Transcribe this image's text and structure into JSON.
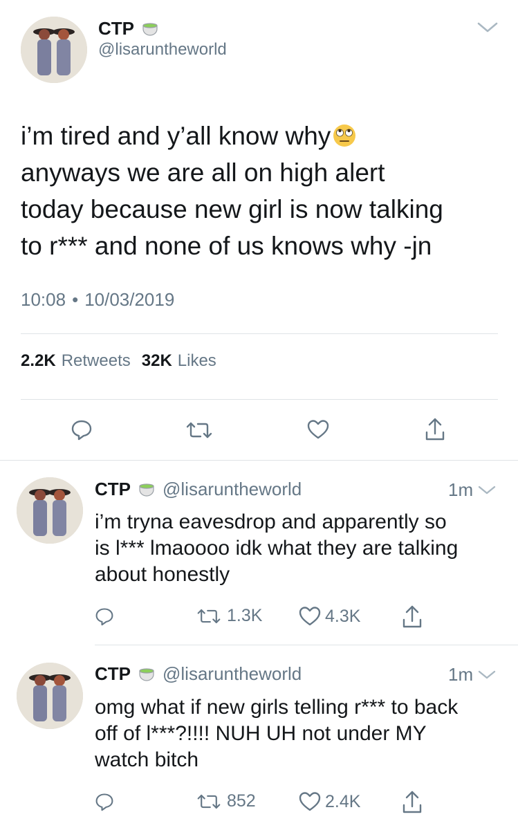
{
  "main_tweet": {
    "display_name": "CTP",
    "handle": "@lisaruntheworld",
    "text_lines": [
      "i’m tired and y’all know why",
      "anyways we are all on high alert",
      "today because new girl is now talking",
      "to r*** and none of us knows why -jn"
    ],
    "time": "10:08",
    "separator": "•",
    "date": "10/03/2019",
    "retweet_count": "2.2K",
    "retweet_label": "Retweets",
    "like_count": "32K",
    "like_label": "Likes"
  },
  "replies": [
    {
      "display_name": "CTP",
      "handle": "@lisaruntheworld",
      "age": "1m",
      "text_lines": [
        "i’m tryna eavesdrop and apparently so",
        "is l*** lmaoooo idk what they are talking",
        "about honestly"
      ],
      "retweets": "1.3K",
      "likes": "4.3K"
    },
    {
      "display_name": "CTP",
      "handle": "@lisaruntheworld",
      "age": "1m",
      "text_lines": [
        "omg what if new girls telling r*** to back",
        "off of l***?!!!! NUH UH not under MY",
        "watch bitch"
      ],
      "retweets": "852",
      "likes": "2.4K"
    }
  ],
  "icons": {
    "name_badge": "tea-cup-emoji",
    "inline_emoji": "eye-roll-emoji",
    "reply": "reply-icon",
    "retweet": "retweet-icon",
    "like": "heart-icon",
    "share": "share-icon",
    "menu": "chevron-down-icon"
  },
  "colors": {
    "text": "#14171a",
    "secondary": "#657786",
    "divider": "#dfe3e6"
  }
}
